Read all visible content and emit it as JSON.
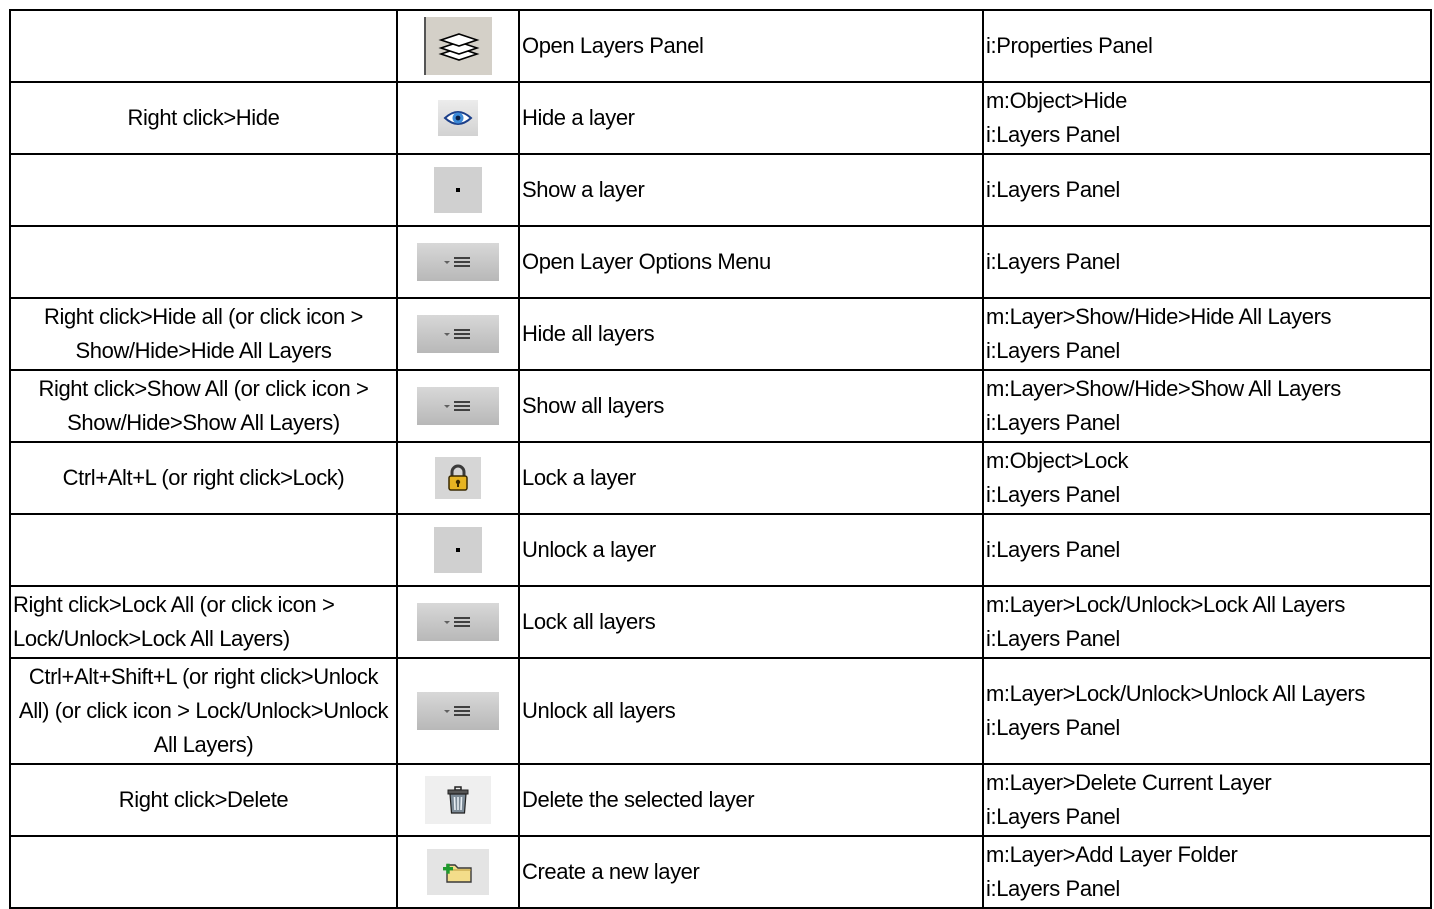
{
  "rows": [
    {
      "shortcut": "",
      "icon": "layers-icon",
      "action": "Open Layers Panel",
      "location": [
        "i:Properties Panel"
      ]
    },
    {
      "shortcut": "Right click>Hide",
      "icon": "eye-icon",
      "action": "Hide a layer",
      "location": [
        "m:Object>Hide",
        "i:Layers Panel"
      ]
    },
    {
      "shortcut": "",
      "icon": "dot-icon",
      "action": "Show a layer",
      "location": [
        "i:Layers Panel"
      ]
    },
    {
      "shortcut": "",
      "icon": "options-menu-icon",
      "action": "Open Layer Options Menu",
      "location": [
        "i:Layers Panel"
      ]
    },
    {
      "shortcut": "Right click>Hide all (or click icon > Show/Hide>Hide All Layers",
      "icon": "options-menu-icon",
      "action": "Hide all layers",
      "location": [
        "m:Layer>Show/Hide>Hide All Layers",
        "i:Layers Panel"
      ]
    },
    {
      "shortcut": "Right click>Show All (or click icon > Show/Hide>Show All Layers)",
      "icon": "options-menu-icon",
      "action": "Show all layers",
      "location": [
        "m:Layer>Show/Hide>Show All Layers",
        "i:Layers Panel"
      ]
    },
    {
      "shortcut": "Ctrl+Alt+L (or right click>Lock)",
      "icon": "lock-icon",
      "action": "Lock a layer",
      "location": [
        "m:Object>Lock",
        "i:Layers Panel"
      ]
    },
    {
      "shortcut": "",
      "icon": "dot-icon",
      "action": "Unlock a layer",
      "location": [
        "i:Layers Panel"
      ]
    },
    {
      "shortcut": "Right click>Lock All (or click icon > Lock/Unlock>Lock All Layers)",
      "icon": "options-menu-icon",
      "action": "Lock all layers",
      "location": [
        "m:Layer>Lock/Unlock>Lock All Layers",
        "i:Layers Panel"
      ]
    },
    {
      "shortcut": "Ctrl+Alt+Shift+L (or right click>Unlock All) (or click icon > Lock/Unlock>Unlock All Layers)",
      "icon": "options-menu-icon",
      "action": "Unlock all layers",
      "location": [
        "m:Layer>Lock/Unlock>Unlock All Layers",
        "i:Layers Panel"
      ]
    },
    {
      "shortcut": "Right click>Delete",
      "icon": "trash-icon",
      "action": "Delete the selected layer",
      "location": [
        "m:Layer>Delete Current Layer",
        "i:Layers Panel"
      ]
    },
    {
      "shortcut": "",
      "icon": "new-folder-icon",
      "action": "Create a new layer",
      "location": [
        "m:Layer>Add Layer Folder",
        "i:Layers Panel"
      ]
    }
  ]
}
